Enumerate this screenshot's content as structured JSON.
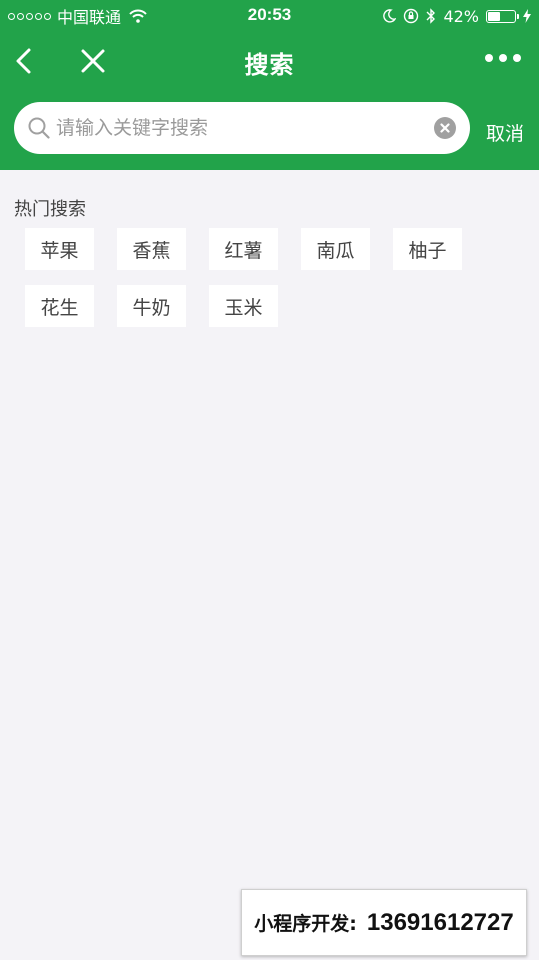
{
  "status_bar": {
    "carrier": "中国联通",
    "time": "20:53",
    "battery": "42%",
    "battery_level": 0.42
  },
  "nav": {
    "title": "搜索"
  },
  "search": {
    "placeholder": "请输入关键字搜索",
    "value": "",
    "cancel_label": "取消"
  },
  "hot": {
    "title": "热门搜索",
    "tags": [
      "苹果",
      "香蕉",
      "红薯",
      "南瓜",
      "柚子",
      "花生",
      "牛奶",
      "玉米"
    ]
  },
  "promo": {
    "label": "小程序开发:",
    "number": "13691612727"
  },
  "colors": {
    "brand_green": "#22a34a",
    "page_background": "#f4f3f7"
  }
}
